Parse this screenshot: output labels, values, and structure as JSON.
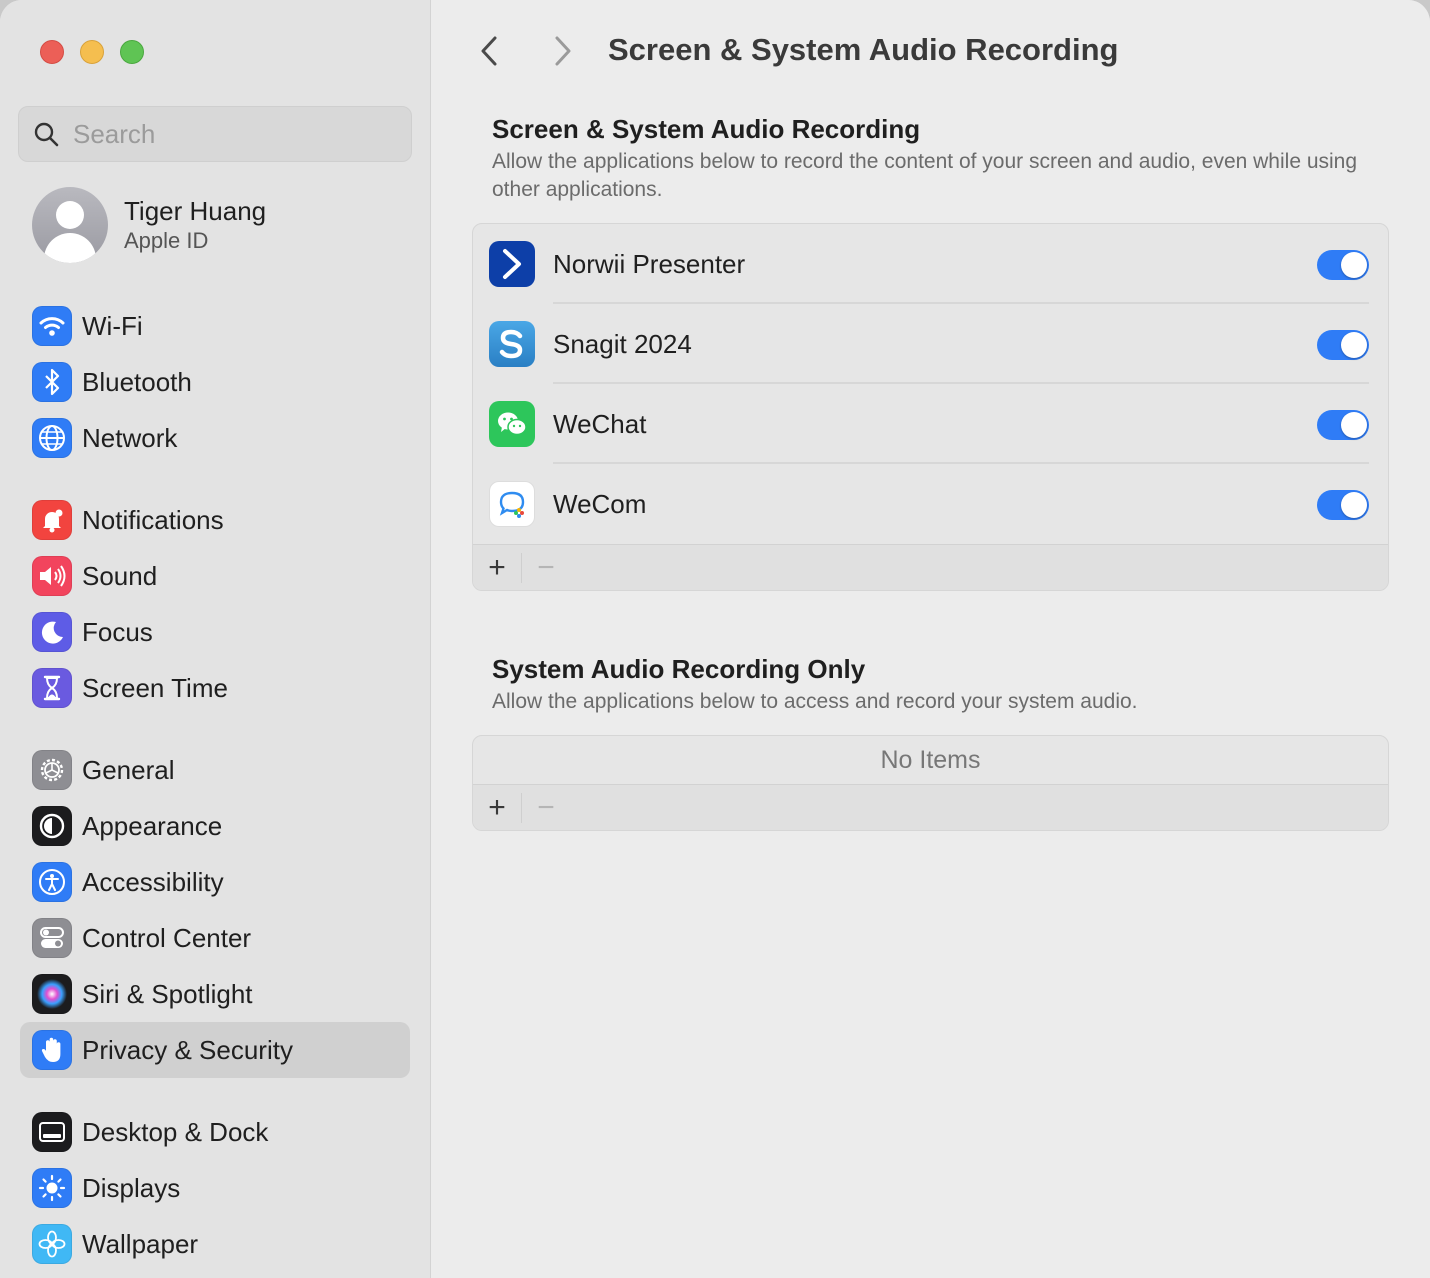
{
  "window": {
    "title": "Screen & System Audio Recording"
  },
  "search": {
    "placeholder": "Search"
  },
  "profile": {
    "name": "Tiger Huang",
    "subtitle": "Apple ID"
  },
  "sidebar": {
    "items": [
      {
        "label": "Wi-Fi",
        "icon": "wifi-icon",
        "color": "#2f7cf6"
      },
      {
        "label": "Bluetooth",
        "icon": "bluetooth-icon",
        "color": "#2f7cf6"
      },
      {
        "label": "Network",
        "icon": "globe-icon",
        "color": "#2f7cf6"
      },
      {
        "label": "Notifications",
        "icon": "bell-icon",
        "color": "#f2443f"
      },
      {
        "label": "Sound",
        "icon": "speaker-icon",
        "color": "#f2445d"
      },
      {
        "label": "Focus",
        "icon": "moon-icon",
        "color": "#5e5ce6"
      },
      {
        "label": "Screen Time",
        "icon": "hourglass-icon",
        "color": "#6a5ae0"
      },
      {
        "label": "General",
        "icon": "gear-icon",
        "color": "#8e8e93"
      },
      {
        "label": "Appearance",
        "icon": "appearance-icon",
        "color": "#1c1c1e"
      },
      {
        "label": "Accessibility",
        "icon": "accessibility-icon",
        "color": "#2f7cf6"
      },
      {
        "label": "Control Center",
        "icon": "switches-icon",
        "color": "#8e8e93"
      },
      {
        "label": "Siri & Spotlight",
        "icon": "siri-icon",
        "color": "#1c1c1e"
      },
      {
        "label": "Privacy & Security",
        "icon": "hand-icon",
        "color": "#2f7cf6",
        "selected": true
      },
      {
        "label": "Desktop & Dock",
        "icon": "dock-icon",
        "color": "#1c1c1e"
      },
      {
        "label": "Displays",
        "icon": "sun-icon",
        "color": "#2f7cf6"
      },
      {
        "label": "Wallpaper",
        "icon": "flower-icon",
        "color": "#40b8f5"
      }
    ]
  },
  "sections": {
    "screen": {
      "title": "Screen & System Audio Recording",
      "description": "Allow the applications below to record the content of your screen and audio, even while using other applications.",
      "apps": [
        {
          "name": "Norwii Presenter",
          "icon": "norwii-icon",
          "enabled": true
        },
        {
          "name": "Snagit 2024",
          "icon": "snagit-icon",
          "enabled": true
        },
        {
          "name": "WeChat",
          "icon": "wechat-icon",
          "enabled": true
        },
        {
          "name": "WeCom",
          "icon": "wecom-icon",
          "enabled": true
        }
      ],
      "add_label": "+",
      "remove_label": "−"
    },
    "audio": {
      "title": "System Audio Recording Only",
      "description": "Allow the applications below to access and record your system audio.",
      "empty_text": "No Items",
      "add_label": "+",
      "remove_label": "−"
    }
  }
}
